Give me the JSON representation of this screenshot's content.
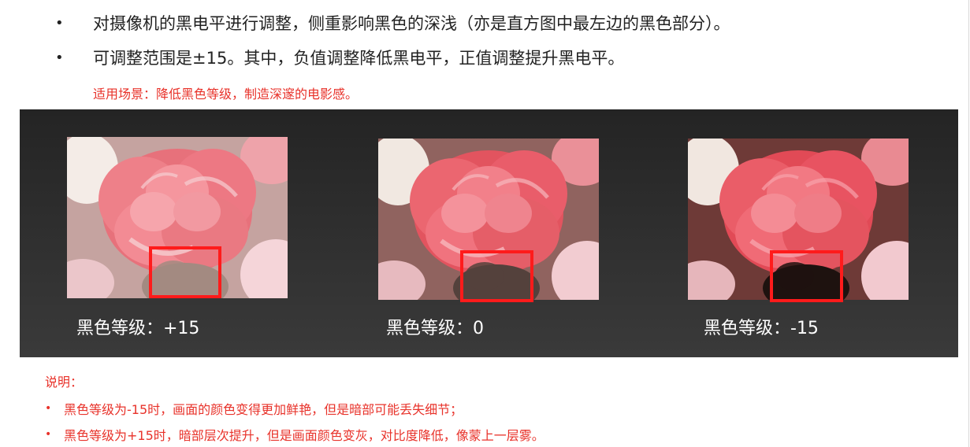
{
  "intro": {
    "bullet_1": "对摄像机的黑电平进行调整，侧重影响黑色的深浅（亦是直方图中最左边的黑色部分）。",
    "bullet_2": "可调整范围是±15。其中，负值调整降低黑电平，正值调整提升黑电平。",
    "usage_note": "适用场景：降低黑色等级，制造深邃的电影感。",
    "bullet_symbol": "•"
  },
  "samples": [
    {
      "label": "黑色等级：+15",
      "tone": "lifted",
      "shadow_color": "#8a6a5e"
    },
    {
      "label": "黑色等级：0",
      "tone": "neutral",
      "shadow_color": "#4a3630"
    },
    {
      "label": "黑色等级：-15",
      "tone": "crushed",
      "shadow_color": "#1e120f"
    }
  ],
  "notes": {
    "title": "说明：",
    "items": [
      "黑色等级为-15时，画面的颜色变得更加鲜艳，但是暗部可能丢失细节；",
      "黑色等级为+15时，暗部层次提升，但是画面颜色变灰，对比度降低，像蒙上一层雾。"
    ],
    "bullet_symbol": "•"
  },
  "colors": {
    "accent_red": "#e8322a",
    "highlight_box": "#ff1b1b",
    "panel_bg": "#2b2b2b",
    "petal": "#e84a57"
  }
}
